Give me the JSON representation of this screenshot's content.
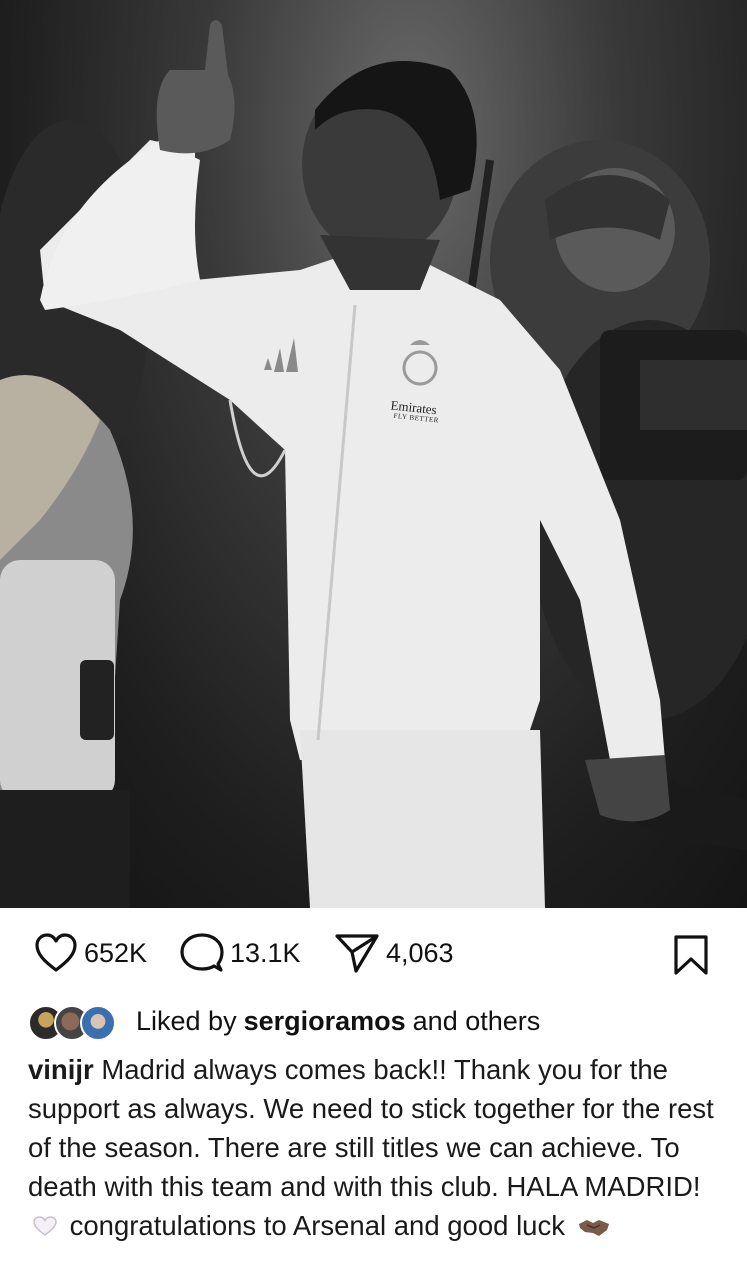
{
  "post": {
    "photo_icon": "player-pointing-up-photo",
    "jacket_sponsor": "Emirates",
    "jacket_tagline": "FLY BETTER"
  },
  "actions": {
    "likes": "652K",
    "comments": "13.1K",
    "shares": "4,063",
    "like_icon": "heart-icon",
    "comment_icon": "comment-icon",
    "share_icon": "send-icon",
    "save_icon": "bookmark-icon"
  },
  "liked_by": {
    "prefix": "Liked by",
    "user": "sergioramos",
    "suffix": "and others"
  },
  "caption": {
    "username": "vinijr",
    "text_1": "Madrid always comes back!! Thank you for the support as always. We need to stick together for the rest of the season. There are still titles we can achieve. To death with this team and with this club. HALA MADRID!",
    "text_2": "congratulations to Arsenal and good luck",
    "emoji_1": "white-heart",
    "emoji_2": "handshake"
  }
}
